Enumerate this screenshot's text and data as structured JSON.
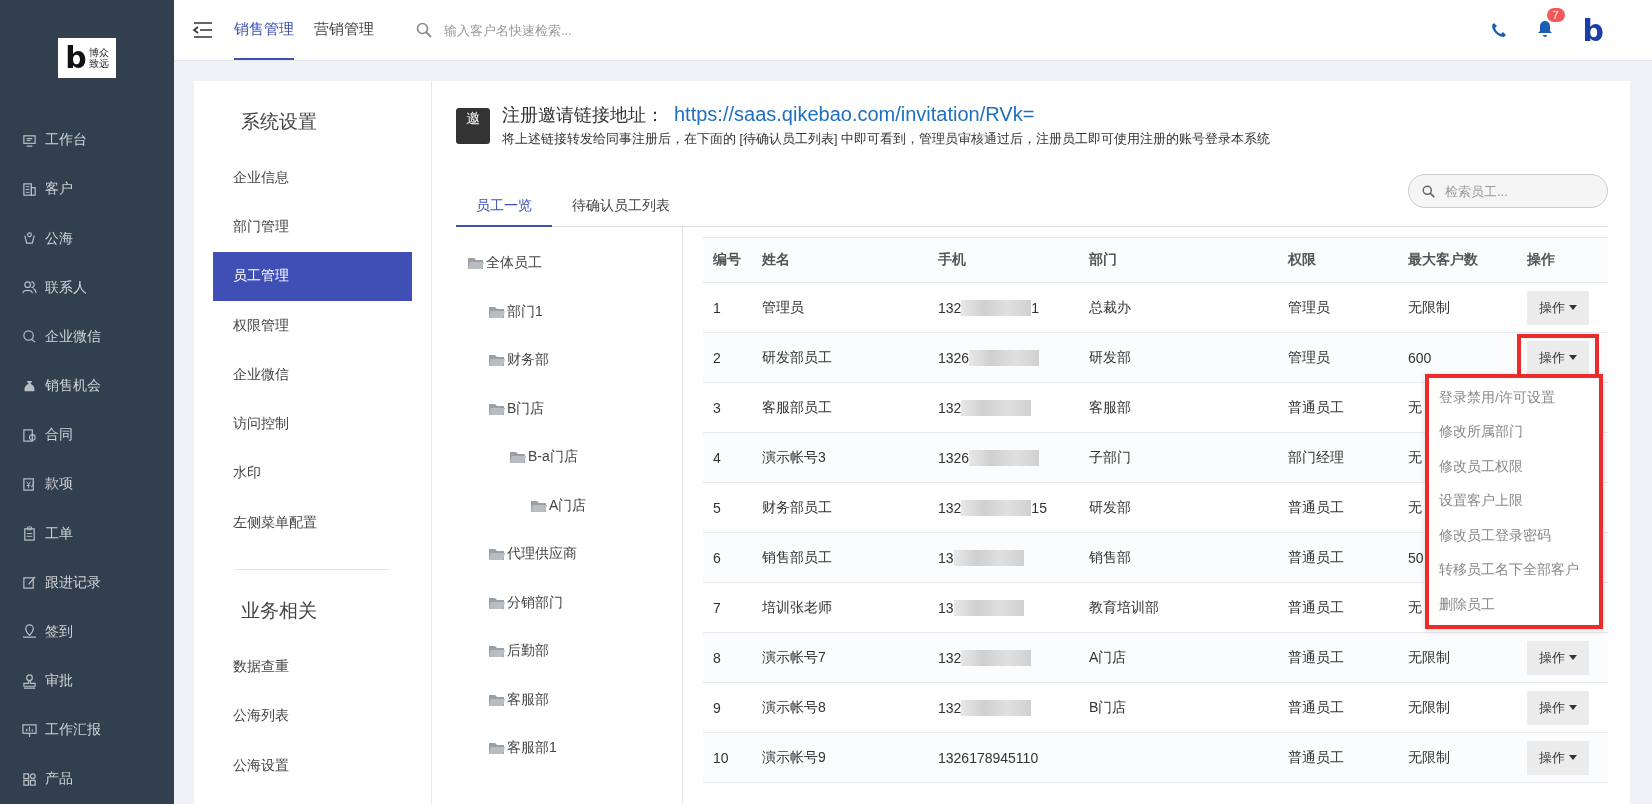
{
  "sidebar": {
    "logo": {
      "mark": "b",
      "lines": [
        "博众",
        "致远"
      ]
    },
    "items": [
      {
        "label": "工作台"
      },
      {
        "label": "客户"
      },
      {
        "label": "公海"
      },
      {
        "label": "联系人"
      },
      {
        "label": "企业微信"
      },
      {
        "label": "销售机会"
      },
      {
        "label": "合同"
      },
      {
        "label": "款项"
      },
      {
        "label": "工单"
      },
      {
        "label": "跟进记录"
      },
      {
        "label": "签到"
      },
      {
        "label": "审批"
      },
      {
        "label": "工作汇报"
      },
      {
        "label": "产品"
      }
    ]
  },
  "topbar": {
    "tabs": [
      {
        "label": "销售管理",
        "selected": true
      },
      {
        "label": "营销管理",
        "selected": false
      }
    ],
    "search": {
      "placeholder": "输入客户名快速检索..."
    },
    "notifications": "7",
    "brand_mark": "b"
  },
  "settings": {
    "sections": [
      {
        "title": "系统设置",
        "items": [
          {
            "label": "企业信息",
            "selected": false
          },
          {
            "label": "部门管理",
            "selected": false
          },
          {
            "label": "员工管理",
            "selected": true
          },
          {
            "label": "权限管理",
            "selected": false
          },
          {
            "label": "企业微信",
            "selected": false
          },
          {
            "label": "访问控制",
            "selected": false
          },
          {
            "label": "水印",
            "selected": false
          },
          {
            "label": "左侧菜单配置",
            "selected": false
          }
        ]
      },
      {
        "title": "业务相关",
        "items": [
          {
            "label": "数据查重",
            "selected": false
          },
          {
            "label": "公海列表",
            "selected": false
          },
          {
            "label": "公海设置",
            "selected": false
          }
        ]
      }
    ]
  },
  "invite": {
    "icon_char": "邀",
    "title": "注册邀请链接地址：",
    "link": "https://saas.qikebao.com/invitation/RVk=",
    "note": "将上述链接转发给同事注册后，在下面的 [待确认员工列表] 中即可看到，管理员审核通过后，注册员工即可使用注册的账号登录本系统"
  },
  "tabs": [
    {
      "label": "员工一览",
      "selected": true
    },
    {
      "label": "待确认员工列表",
      "selected": false
    }
  ],
  "staff_search": {
    "placeholder": "检索员工..."
  },
  "tree": [
    {
      "label": "全体员工",
      "children": [
        {
          "label": "部门1"
        },
        {
          "label": "财务部"
        },
        {
          "label": "B门店",
          "children": [
            {
              "label": "B-a门店",
              "children": [
                {
                  "label": "A门店"
                }
              ]
            }
          ]
        },
        {
          "label": "代理供应商"
        },
        {
          "label": "分销部门"
        },
        {
          "label": "后勤部"
        },
        {
          "label": "客服部"
        },
        {
          "label": "客服部1"
        }
      ]
    }
  ],
  "table": {
    "columns": [
      "编号",
      "姓名",
      "手机",
      "部门",
      "权限",
      "最大客户数",
      "操作"
    ],
    "rows": [
      {
        "no": "1",
        "name": "管理员",
        "phone": {
          "start": "132",
          "end": "1",
          "blurred": true
        },
        "dept": "总裁办",
        "role": "管理员",
        "max": "无限制",
        "action": "操作",
        "highlighted": false
      },
      {
        "no": "2",
        "name": "研发部员工",
        "phone": {
          "start": "1326",
          "blurred": true
        },
        "dept": "研发部",
        "role": "管理员",
        "max": "600",
        "action": "操作",
        "highlighted": true,
        "menu": {
          "highlighted": true,
          "items": [
            "登录禁用/许可设置",
            "修改所属部门",
            "修改员工权限",
            "设置客户上限",
            "修改员工登录密码",
            "转移员工名下全部客户",
            "删除员工"
          ]
        }
      },
      {
        "no": "3",
        "name": "客服部员工",
        "phone": {
          "start": "132",
          "blurred": true
        },
        "dept": "客服部",
        "role": "普通员工",
        "max": "无"
      },
      {
        "no": "4",
        "name": "演示帐号3",
        "phone": {
          "start": "1326",
          "blurred": true
        },
        "dept": "子部门",
        "role": "部门经理",
        "max": "无"
      },
      {
        "no": "5",
        "name": "财务部员工",
        "phone": {
          "start": "132",
          "end": "15",
          "blurred": true
        },
        "dept": "研发部",
        "role": "普通员工",
        "max": "无"
      },
      {
        "no": "6",
        "name": "销售部员工",
        "phone": {
          "start": "13",
          "blurred": true
        },
        "dept": "销售部",
        "role": "普通员工",
        "max": "50"
      },
      {
        "no": "7",
        "name": "培训张老师",
        "phone": {
          "start": "13",
          "blurred": true
        },
        "dept": "教育培训部",
        "role": "普通员工",
        "max": "无"
      },
      {
        "no": "8",
        "name": "演示帐号7",
        "phone": {
          "start": "132",
          "blurred": true
        },
        "dept": "A门店",
        "role": "普通员工",
        "max": "无限制",
        "action": "操作",
        "highlighted": false
      },
      {
        "no": "9",
        "name": "演示帐号8",
        "phone": {
          "start": "132",
          "blurred": true
        },
        "dept": "B门店",
        "role": "普通员工",
        "max": "无限制",
        "action": "操作",
        "highlighted": false
      },
      {
        "no": "10",
        "name": "演示帐号9",
        "phone": {
          "start": "1326178945110",
          "blurred": false
        },
        "role": "普通员工",
        "max": "无限制",
        "action": "操作",
        "highlighted": false
      }
    ]
  }
}
